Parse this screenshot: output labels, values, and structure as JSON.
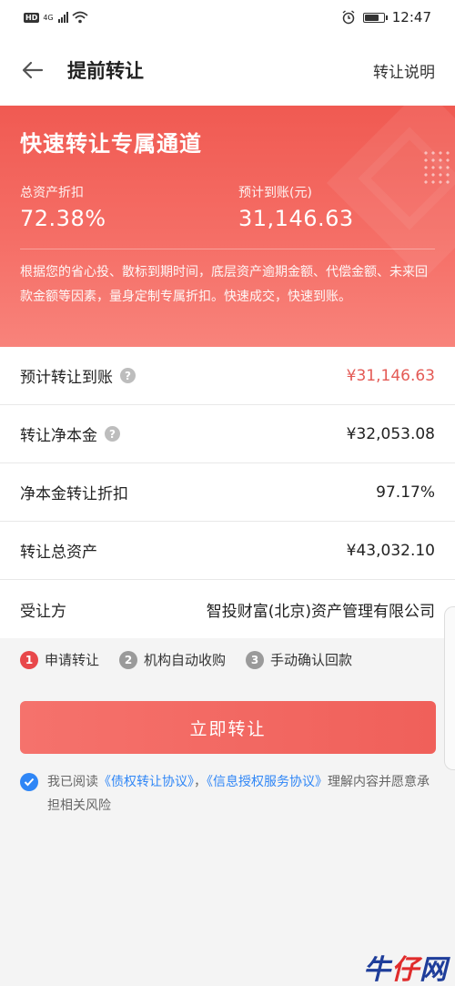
{
  "status_bar": {
    "hd": "HD",
    "network": "4G",
    "time": "12:47",
    "battery_level": 0.8
  },
  "nav": {
    "title": "提前转让",
    "action": "转让说明"
  },
  "hero": {
    "title": "快速转让专属通道",
    "discount_label": "总资产折扣",
    "discount_value": "72.38%",
    "expected_label": "预计到账(元)",
    "expected_value": "31,146.63",
    "description": "根据您的省心投、散标到期时间，底层资产逾期金额、代偿金额、未来回款金额等因素，量身定制专属折扣。快速成交，快速到账。"
  },
  "rows": [
    {
      "label": "预计转让到账",
      "value": "¥31,146.63",
      "help": true,
      "accent": true
    },
    {
      "label": "转让净本金",
      "value": "¥32,053.08",
      "help": true,
      "accent": false
    },
    {
      "label": "净本金转让折扣",
      "value": "97.17%",
      "help": false,
      "accent": false
    },
    {
      "label": "转让总资产",
      "value": "¥43,032.10",
      "help": false,
      "accent": false
    },
    {
      "label": "受让方",
      "value": "智投财富(北京)资产管理有限公司",
      "help": false,
      "accent": false
    }
  ],
  "steps": [
    {
      "num": "1",
      "label": "申请转让",
      "color": "#e8474a"
    },
    {
      "num": "2",
      "label": "机构自动收购",
      "color": "#9a9a9a"
    },
    {
      "num": "3",
      "label": "手动确认回款",
      "color": "#9a9a9a"
    }
  ],
  "button": {
    "label": "立即转让"
  },
  "agreement": {
    "prefix": "我已阅读",
    "link1": "《债权转让协议》",
    "sep": "，",
    "link2": "《信息授权服务协议》",
    "suffix": "理解内容并愿意承担相关风险"
  },
  "watermark": {
    "w1": "牛",
    "w2": "仔",
    "w3": "网"
  },
  "colors": {
    "accent": "#e45a55",
    "hero": "#f05a52",
    "link": "#2f86f6"
  }
}
